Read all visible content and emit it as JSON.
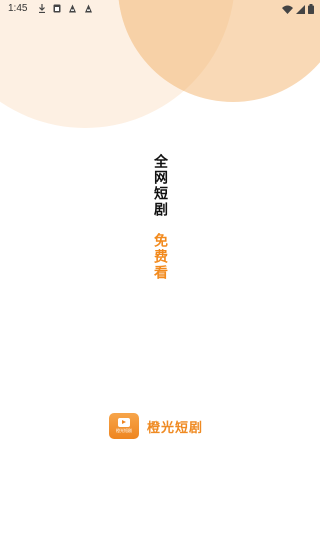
{
  "status_bar": {
    "time": "1:45",
    "icons_left": [
      "download-icon",
      "sim-icon",
      "a-icon",
      "a-icon"
    ],
    "icons_right": [
      "wifi-icon",
      "signal-icon",
      "battery-icon"
    ]
  },
  "slogan": {
    "line1": "全网短剧",
    "line2": "免费看"
  },
  "brand": {
    "logo_text": "橙光短剧",
    "name": "橙光短剧"
  },
  "colors": {
    "accent": "#f28a1d",
    "blob_light": "#fdf0e3",
    "blob_dark": "#f9d9b6",
    "text_dark": "#111111"
  }
}
